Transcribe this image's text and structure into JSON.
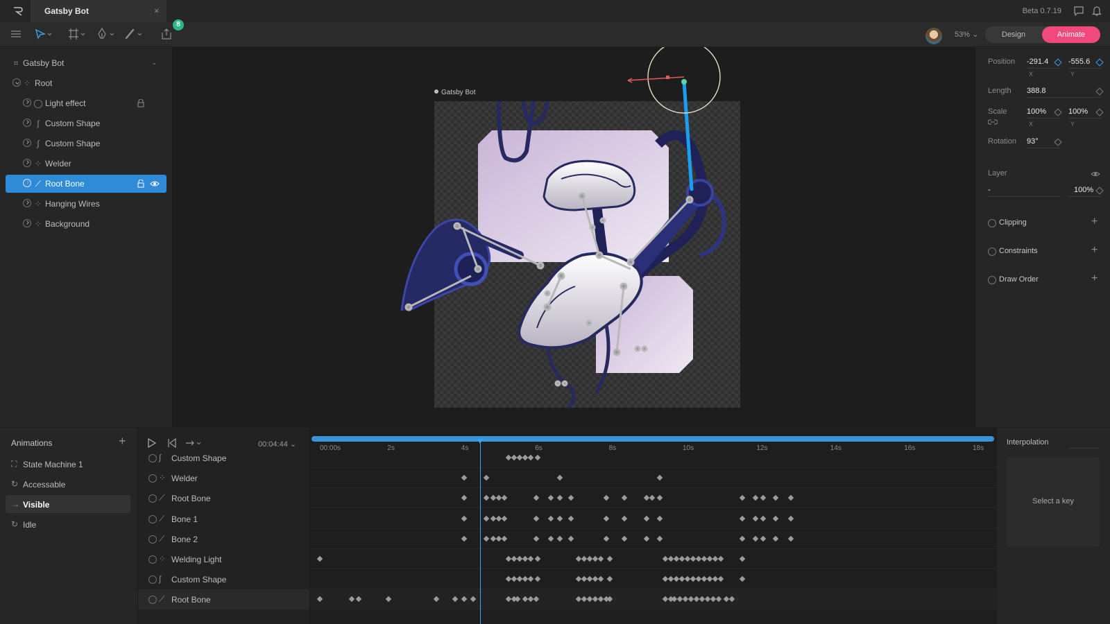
{
  "window": {
    "tab_title": "Gatsby Bot",
    "close_icon": "×",
    "version": "Beta 0.7.19"
  },
  "toolbar": {
    "badge_count": "8",
    "zoom": "53%",
    "design_label": "Design",
    "animate_label": "Animate"
  },
  "hierarchy": {
    "artboard": "Gatsby Bot",
    "items": [
      {
        "label": "Root",
        "icon": "group"
      },
      {
        "label": "Light effect",
        "icon": "ellipse"
      },
      {
        "label": "Custom Shape",
        "icon": "path"
      },
      {
        "label": "Custom Shape",
        "icon": "path"
      },
      {
        "label": "Welder",
        "icon": "group"
      },
      {
        "label": "Root Bone",
        "icon": "bone"
      },
      {
        "label": "Hanging Wires",
        "icon": "group"
      },
      {
        "label": "Background",
        "icon": "group"
      }
    ]
  },
  "canvas": {
    "artboard_label": "Gatsby Bot"
  },
  "inspector": {
    "position_label": "Position",
    "position_x": "-291.4",
    "position_y": "-555.6",
    "x_label": "X",
    "y_label": "Y",
    "length_label": "Length",
    "length": "388.8",
    "scale_label": "Scale",
    "scale_x": "100%",
    "scale_y": "100%",
    "rotation_label": "Rotation",
    "rotation": "93°",
    "layer_label": "Layer",
    "layer_blend": "-",
    "layer_opacity": "100%",
    "clipping_label": "Clipping",
    "constraints_label": "Constraints",
    "draw_order_label": "Draw Order"
  },
  "animations": {
    "title": "Animations",
    "items": [
      {
        "label": "State Machine 1",
        "icon": "state-machine"
      },
      {
        "label": "Accessable",
        "icon": "loop"
      },
      {
        "label": "Visible",
        "icon": "one-shot"
      },
      {
        "label": "Idle",
        "icon": "loop"
      }
    ]
  },
  "timeline": {
    "current_time": "00:04:44",
    "ticks": [
      "00:00s",
      "2s",
      "4s",
      "6s",
      "8s",
      "10s",
      "12s",
      "14s",
      "16s",
      "18s"
    ],
    "playhead_seconds": 4.44,
    "tracks": [
      {
        "label": "Custom Shape",
        "icon": "path",
        "keys": [
          5.2,
          5.35,
          5.5,
          5.65,
          5.8,
          6.0
        ]
      },
      {
        "label": "Welder",
        "icon": "group",
        "keys": [
          4.0,
          4.6,
          6.6,
          9.3
        ]
      },
      {
        "label": "Root Bone",
        "icon": "bone",
        "keys": [
          4.0,
          4.6,
          4.8,
          4.95,
          5.1,
          5.95,
          6.35,
          6.6,
          6.9,
          7.85,
          8.35,
          8.95,
          9.1,
          9.3,
          11.55,
          11.9,
          12.1,
          12.45,
          12.85
        ]
      },
      {
        "label": "Bone 1",
        "icon": "bone",
        "keys": [
          4.0,
          4.6,
          4.8,
          4.95,
          5.1,
          5.95,
          6.35,
          6.6,
          6.9,
          7.85,
          8.35,
          8.95,
          9.3,
          11.55,
          11.9,
          12.1,
          12.45,
          12.85
        ]
      },
      {
        "label": "Bone 2",
        "icon": "bone",
        "keys": [
          4.0,
          4.6,
          4.8,
          4.95,
          5.1,
          5.95,
          6.35,
          6.6,
          6.9,
          7.85,
          8.35,
          8.95,
          9.3,
          11.55,
          11.9,
          12.1,
          12.45,
          12.85
        ]
      },
      {
        "label": "Welding Light",
        "icon": "group",
        "keys": [
          0.1,
          5.2,
          5.35,
          5.5,
          5.65,
          5.8,
          6.0,
          7.1,
          7.25,
          7.4,
          7.55,
          7.7,
          7.95,
          9.45,
          9.6,
          9.75,
          9.9,
          10.05,
          10.2,
          10.35,
          10.5,
          10.65,
          10.8,
          10.95,
          11.55
        ]
      },
      {
        "label": "Custom Shape",
        "icon": "path",
        "keys": [
          5.2,
          5.35,
          5.5,
          5.65,
          5.8,
          6.0,
          7.1,
          7.25,
          7.4,
          7.55,
          7.7,
          7.95,
          9.45,
          9.6,
          9.75,
          9.9,
          10.05,
          10.2,
          10.35,
          10.5,
          10.65,
          10.8,
          10.95,
          11.55
        ]
      },
      {
        "label": "Root Bone",
        "icon": "bone",
        "keys": [
          0.1,
          0.95,
          1.15,
          1.95,
          3.25,
          3.75,
          4.0,
          4.25,
          5.2,
          5.35,
          5.45,
          5.65,
          5.8,
          5.95,
          7.1,
          7.25,
          7.4,
          7.55,
          7.7,
          7.85,
          7.95,
          9.45,
          9.6,
          9.7,
          9.85,
          10.0,
          10.15,
          10.3,
          10.45,
          10.6,
          10.75,
          10.9,
          11.1,
          11.25
        ]
      }
    ],
    "interpolation_label": "Interpolation",
    "select_key_text": "Select a key"
  }
}
